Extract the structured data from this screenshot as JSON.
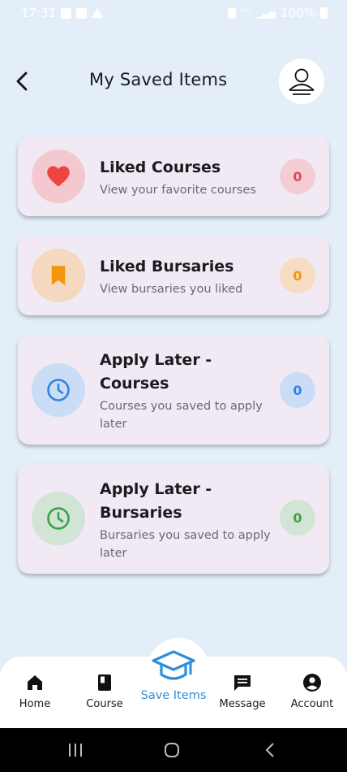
{
  "status_bar": {
    "time": "17:31",
    "battery": "100%"
  },
  "header": {
    "title": "My Saved Items",
    "back_icon": "chevron-left-icon",
    "avatar_icon": "user-icon"
  },
  "cards": [
    {
      "title_line1": "Liked Courses",
      "title_line2": "",
      "subtitle": "View your favorite courses",
      "count": "0",
      "icon": "heart-icon",
      "icon_color": "#ef4343",
      "circle_color": "#f3c9cf",
      "badge_bg": "#f4ccd4",
      "badge_color": "#e24a4a"
    },
    {
      "title_line1": "Liked Bursaries",
      "title_line2": "",
      "subtitle": "View bursaries you liked",
      "count": "0",
      "icon": "bookmark-icon",
      "icon_color": "#f4960d",
      "circle_color": "#f5d8c0",
      "badge_bg": "#f6dcc3",
      "badge_color": "#f4960d"
    },
    {
      "title_line1": "Apply Later -",
      "title_line2": "Courses",
      "subtitle": "Courses you saved to apply later",
      "count": "0",
      "icon": "clock-icon",
      "icon_color": "#2f86e0",
      "circle_color": "#cbdcf6",
      "badge_bg": "#cbdcf6",
      "badge_color": "#2f86e0"
    },
    {
      "title_line1": "Apply Later -",
      "title_line2": "Bursaries",
      "subtitle": "Bursaries you saved to apply later",
      "count": "0",
      "icon": "clock-icon",
      "icon_color": "#3ba24a",
      "circle_color": "#d2e4d5",
      "badge_bg": "#d2e4d5",
      "badge_color": "#3ba24a"
    }
  ],
  "bottom_nav": {
    "home": "Home",
    "course": "Course",
    "save_items": "Save Items",
    "message": "Message",
    "account": "Account",
    "active_color": "#2d8fdc"
  }
}
